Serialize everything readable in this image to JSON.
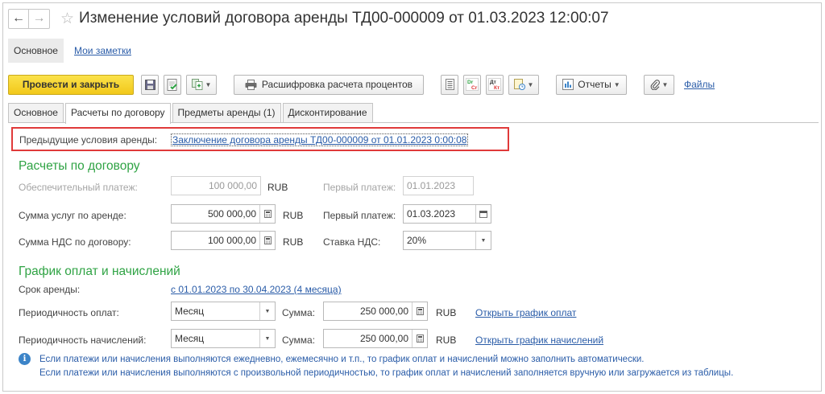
{
  "window": {
    "title": "Изменение условий договора аренды ТД00-000009 от 01.03.2023 12:00:07"
  },
  "topnav": {
    "main_label": "Основное",
    "notes_label": "Мои заметки"
  },
  "toolbar": {
    "post_close_label": "Провести и закрыть",
    "interest_calc_label": "Расшифровка расчета процентов",
    "reports_label": "Отчеты",
    "files_label": "Файлы",
    "dr_label": "Dr",
    "cr_label": "Cr",
    "dt_label": "Дт",
    "kt_label": "Кт"
  },
  "tabs": [
    {
      "label": "Основное"
    },
    {
      "label": "Расчеты по договору"
    },
    {
      "label": "Предметы аренды (1)"
    },
    {
      "label": "Дисконтирование"
    }
  ],
  "previous": {
    "label": "Предыдущие условия аренды:",
    "link": "Заключение договора аренды ТД00-000009 от 01.01.2023 0:00:08"
  },
  "settlements": {
    "title": "Расчеты по договору",
    "deposit_label": "Обеспечительный платеж:",
    "deposit_value": "100 000,00",
    "deposit_currency": "RUB",
    "deposit_first_label": "Первый платеж:",
    "deposit_first_value": "01.01.2023",
    "rent_label": "Сумма услуг по аренде:",
    "rent_value": "500 000,00",
    "rent_currency": "RUB",
    "rent_first_label": "Первый платеж:",
    "rent_first_value": "01.03.2023",
    "vat_label": "Сумма НДС по договору:",
    "vat_value": "100 000,00",
    "vat_currency": "RUB",
    "vat_rate_label": "Ставка НДС:",
    "vat_rate_value": "20%"
  },
  "schedule": {
    "title": "График оплат и начислений",
    "term_label": "Срок аренды:",
    "term_value": "с 01.01.2023 по 30.04.2023 (4 месяца)",
    "pay_period_label": "Периодичность оплат:",
    "pay_period_value": "Месяц",
    "pay_sum_label": "Сумма:",
    "pay_sum_value": "250 000,00",
    "pay_currency": "RUB",
    "pay_link": "Открыть график оплат",
    "acc_period_label": "Периодичность начислений:",
    "acc_period_value": "Месяц",
    "acc_sum_label": "Сумма:",
    "acc_sum_value": "250 000,00",
    "acc_currency": "RUB",
    "acc_link": "Открыть график начислений"
  },
  "note": {
    "line1": "Если платежи или начисления выполняются ежедневно, ежемесячно и т.п., то график оплат и начислений можно заполнить автоматически.",
    "line2": "Если платежи или начисления выполняются с произвольной периодичностью, то график оплат и начислений заполняется вручную или загружается из таблицы."
  }
}
